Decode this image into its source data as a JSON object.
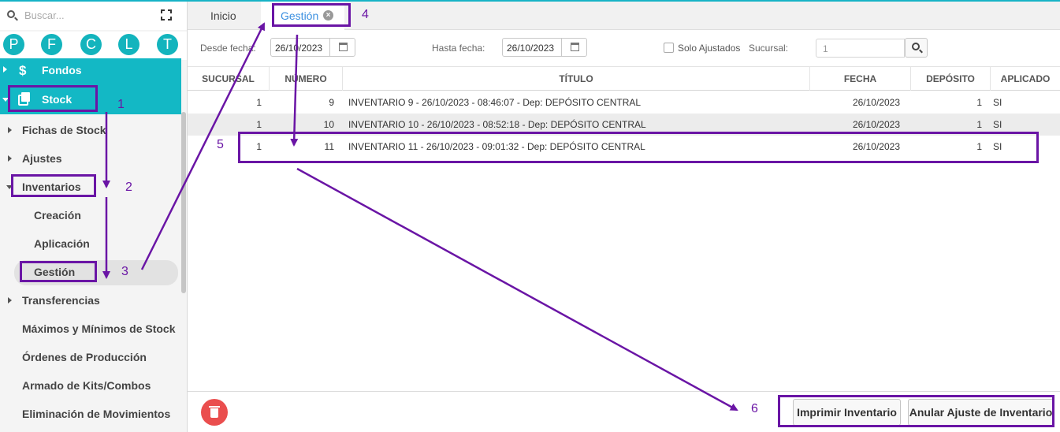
{
  "search": {
    "placeholder": "Buscar..."
  },
  "shortcuts": [
    "P",
    "F",
    "C",
    "L",
    "T"
  ],
  "sidebar": {
    "fondos": "Fondos",
    "stock": "Stock",
    "items": [
      {
        "label": "Fichas de Stock"
      },
      {
        "label": "Ajustes"
      },
      {
        "label": "Inventarios"
      },
      {
        "label": "Creación"
      },
      {
        "label": "Aplicación"
      },
      {
        "label": "Gestión"
      },
      {
        "label": "Transferencias"
      },
      {
        "label": "Máximos y Mínimos de Stock"
      },
      {
        "label": "Órdenes de Producción"
      },
      {
        "label": "Armado de Kits/Combos"
      },
      {
        "label": "Eliminación de Movimientos"
      }
    ]
  },
  "tabs": {
    "inicio": "Inicio",
    "gestion": "Gestión",
    "close": "×"
  },
  "filters": {
    "desde_label": "Desde fecha:",
    "desde_value": "26/10/2023",
    "hasta_label": "Hasta fecha:",
    "hasta_value": "26/10/2023",
    "solo_ajustados": "Solo Ajustados",
    "sucursal_label": "Sucursal:",
    "sucursal_placeholder": "1"
  },
  "table": {
    "headers": [
      "SUCURSAL",
      "NÚMERO",
      "TÍTULO",
      "FECHA",
      "DEPÓSITO",
      "APLICADO"
    ],
    "rows": [
      [
        "1",
        "9",
        "INVENTARIO 9 - 26/10/2023 - 08:46:07 - Dep: DEPÓSITO CENTRAL",
        "26/10/2023",
        "1",
        "SI"
      ],
      [
        "1",
        "10",
        "INVENTARIO 10 - 26/10/2023 - 08:52:18 - Dep: DEPÓSITO CENTRAL",
        "26/10/2023",
        "1",
        "SI"
      ],
      [
        "1",
        "11",
        "INVENTARIO 11 - 26/10/2023 - 09:01:32 - Dep: DEPÓSITO CENTRAL",
        "26/10/2023",
        "1",
        "SI"
      ]
    ]
  },
  "footer": {
    "imprimir": "Imprimir Inventario",
    "anular": "Anular Ajuste de Inventario"
  },
  "annotations": [
    "1",
    "2",
    "3",
    "4",
    "5",
    "6"
  ],
  "colors": {
    "teal": "#13b8c5",
    "annotation": "#6a15a5",
    "delete": "#ea4e4e",
    "tab_active": "#3a8fe0"
  }
}
